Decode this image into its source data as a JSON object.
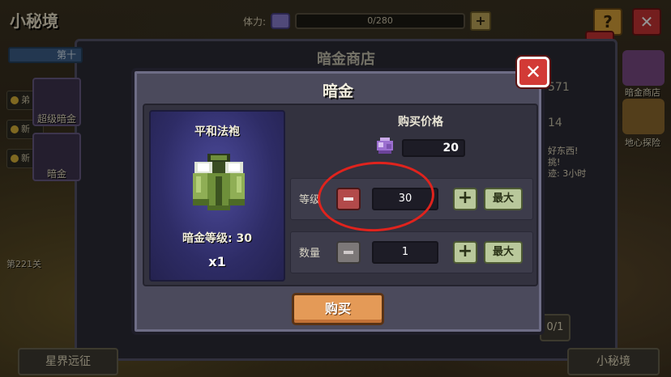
{
  "background": {
    "title": "小秘境",
    "stamina": {
      "label": "体力:",
      "value": "0/280"
    },
    "help_icon": "?",
    "under_panel_title": "暗金商店",
    "left_tab": "第十",
    "left_notices": [
      {
        "label": "弟"
      },
      {
        "label": "新"
      },
      {
        "label": "新"
      }
    ],
    "left_shops": [
      {
        "label": "超级暗金"
      },
      {
        "label": "暗金"
      }
    ],
    "stage": "第221关",
    "right_icons": [
      {
        "label": "暗金商店",
        "color": "#7a4a86"
      },
      {
        "label": "地心探险",
        "color": "#8f6b2f"
      }
    ],
    "right_numbers": [
      "571",
      "14"
    ],
    "right_note": "好东西!\n挑!\n迹: 3小时",
    "fragment_count": "0/1",
    "bottom_left": "星界远征",
    "bottom_right": "小秘境",
    "under_row_label": "新"
  },
  "dialog": {
    "title": "暗金",
    "item": {
      "name": "平和法袍",
      "level_text": "暗金等级: 30",
      "quantity_text": "x1",
      "icon": "green-robe-icon"
    },
    "price": {
      "title": "购买价格",
      "currency_icon": "purple-gem-icon",
      "value": "20"
    },
    "level_row": {
      "label": "等级",
      "value": "30",
      "max_label": "最大"
    },
    "quantity_row": {
      "label": "数量",
      "value": "1",
      "max_label": "最大"
    },
    "buy_label": "购买"
  },
  "colors": {
    "dialog_bg": "#4b4a5c",
    "close_red": "#d23a36",
    "buy_orange": "#e49a57",
    "plus_green": "#b9c89b",
    "minus_red": "#b24a4a",
    "annotation_red": "#e0231d"
  }
}
